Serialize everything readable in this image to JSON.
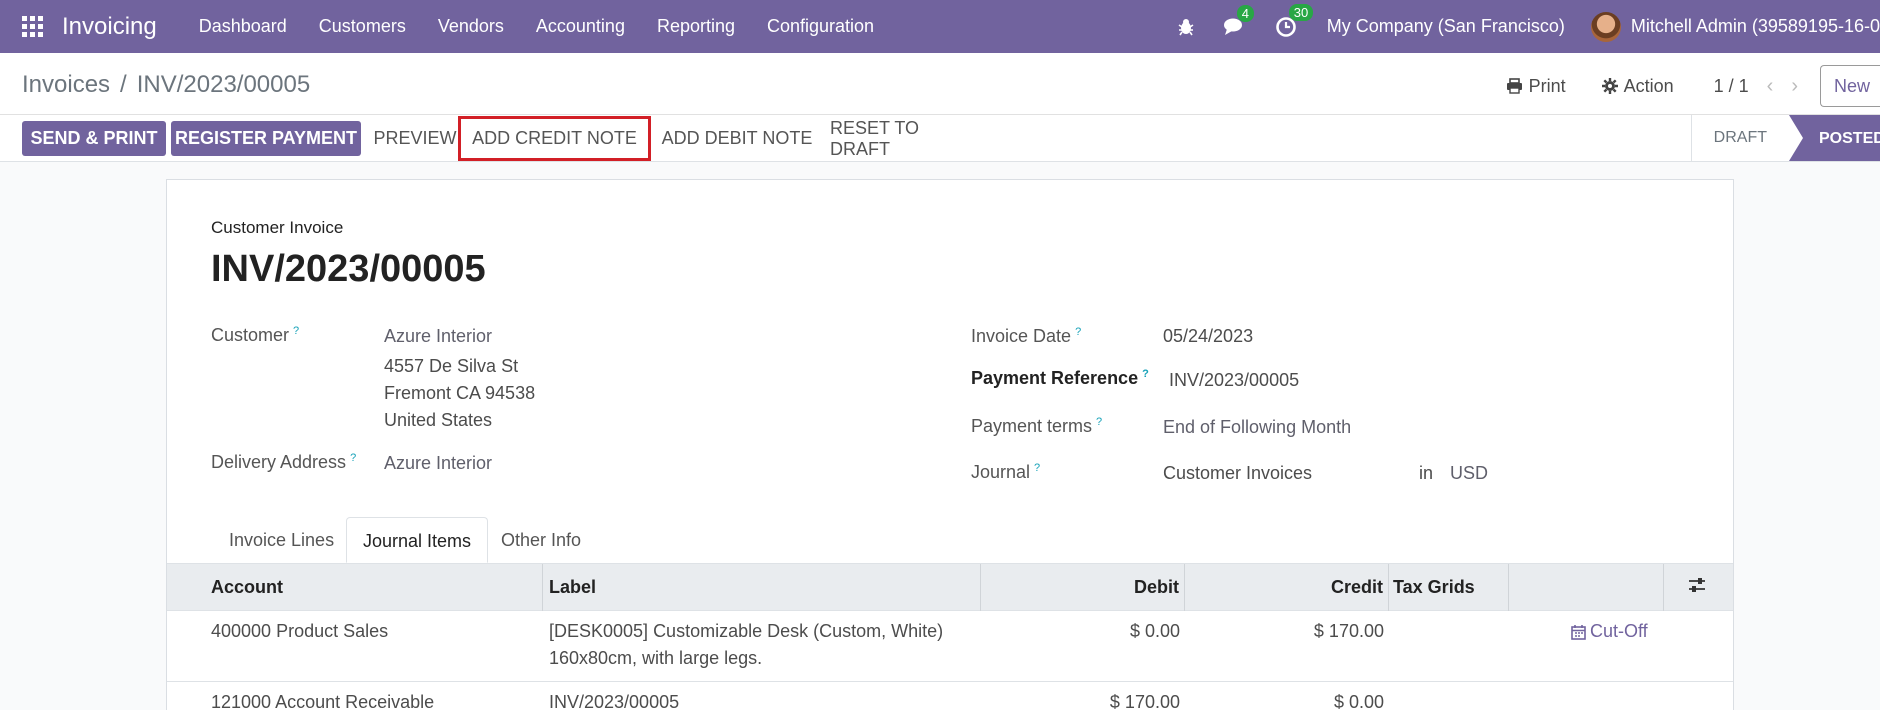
{
  "navbar": {
    "app_name": "Invoicing",
    "menu": [
      "Dashboard",
      "Customers",
      "Vendors",
      "Accounting",
      "Reporting",
      "Configuration"
    ],
    "messages_count": "4",
    "activities_count": "30",
    "company": "My Company (San Francisco)",
    "user": "Mitchell Admin (39589195-16-0"
  },
  "control_panel": {
    "breadcrumb_parent": "Invoices",
    "breadcrumb_sep": "/",
    "breadcrumb_current": "INV/2023/00005",
    "print_label": "Print",
    "action_label": "Action",
    "pager": "1 / 1",
    "new_label": "New"
  },
  "statusbar": {
    "send_print": "SEND & PRINT",
    "register_payment": "REGISTER PAYMENT",
    "preview": "PREVIEW",
    "add_credit_note": "ADD CREDIT NOTE",
    "add_debit_note": "ADD DEBIT NOTE",
    "reset_to_draft": "RESET TO DRAFT",
    "stage_draft": "DRAFT",
    "stage_posted": "POSTED"
  },
  "form": {
    "type": "Customer Invoice",
    "title": "INV/2023/00005",
    "customer_label": "Customer",
    "customer_name": "Azure Interior",
    "address_line1": "4557 De Silva St",
    "address_line2": "Fremont CA 94538",
    "address_line3": "United States",
    "delivery_label": "Delivery Address",
    "delivery_value": "Azure Interior",
    "invoice_date_label": "Invoice Date",
    "invoice_date": "05/24/2023",
    "payment_ref_label": "Payment Reference",
    "payment_ref": "INV/2023/00005",
    "payment_terms_label": "Payment terms",
    "payment_terms": "End of Following Month",
    "journal_label": "Journal",
    "journal": "Customer Invoices",
    "in_label": "in",
    "currency": "USD",
    "help_mark": "?"
  },
  "tabs": [
    "Invoice Lines",
    "Journal Items",
    "Other Info"
  ],
  "table": {
    "headers": [
      "Account",
      "Label",
      "Debit",
      "Credit",
      "Tax Grids"
    ],
    "rows": [
      {
        "account": "400000 Product Sales",
        "label1": "[DESK0005] Customizable Desk (Custom, White)",
        "label2": "160x80cm, with large legs.",
        "debit": "$ 0.00",
        "credit": "$ 170.00",
        "action": "Cut-Off"
      },
      {
        "account": "121000 Account Receivable",
        "label1": "INV/2023/00005",
        "label2": "",
        "debit": "$ 170.00",
        "credit": "$ 0.00",
        "action": ""
      }
    ]
  }
}
